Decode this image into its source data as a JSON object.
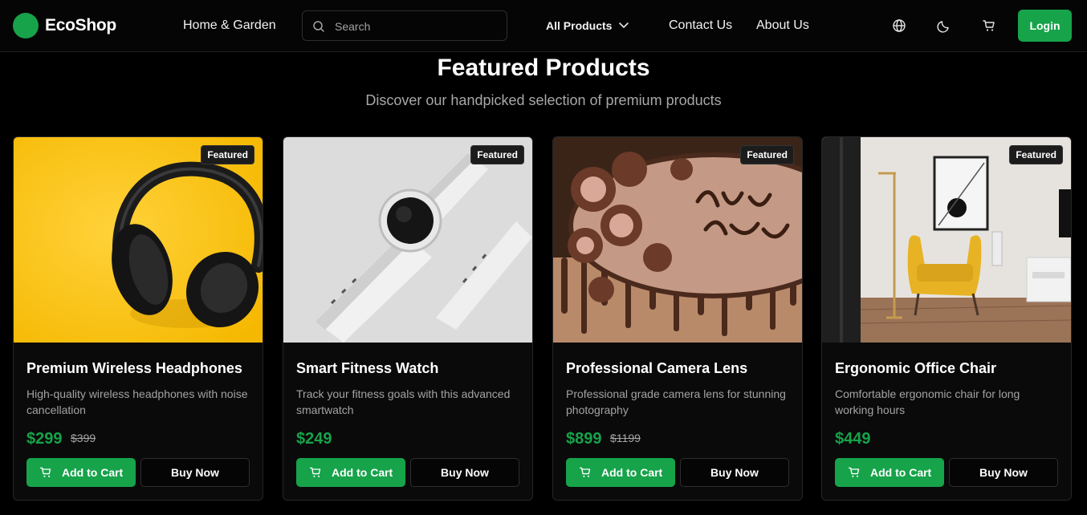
{
  "nav": {
    "brand": "EcoShop",
    "category_link": "Home & Garden",
    "search_placeholder": "Search",
    "products_dropdown": "All Products",
    "contact": "Contact Us",
    "about": "About Us",
    "login": "Login",
    "icons": [
      "globe-icon",
      "moon-icon",
      "cart-icon"
    ]
  },
  "section": {
    "title": "Featured Products",
    "subtitle": "Discover our handpicked selection of premium products"
  },
  "products": [
    {
      "badge": "Featured",
      "name": "Premium Wireless Headphones",
      "description": "High-quality wireless headphones with noise cancellation",
      "price": "$299",
      "old_price": "$399",
      "add_to_cart": "Add to Cart",
      "buy_now": "Buy Now",
      "image": "headphones-image"
    },
    {
      "badge": "Featured",
      "name": "Smart Fitness Watch",
      "description": "Track your fitness goals with this advanced smartwatch",
      "price": "$249",
      "old_price": "",
      "add_to_cart": "Add to Cart",
      "buy_now": "Buy Now",
      "image": "watch-image"
    },
    {
      "badge": "Featured",
      "name": "Professional Camera Lens",
      "description": "Professional grade camera lens for stunning photography",
      "price": "$899",
      "old_price": "$1199",
      "add_to_cart": "Add to Cart",
      "buy_now": "Buy Now",
      "image": "cake-image"
    },
    {
      "badge": "Featured",
      "name": "Ergonomic Office Chair",
      "description": "Comfortable ergonomic chair for long working hours",
      "price": "$449",
      "old_price": "",
      "add_to_cart": "Add to Cart",
      "buy_now": "Buy Now",
      "image": "room-chair-image"
    }
  ],
  "colors": {
    "accent": "#16a34a",
    "background": "#000000",
    "card": "#0a0a0a",
    "muted_text": "#a3a3a3"
  }
}
